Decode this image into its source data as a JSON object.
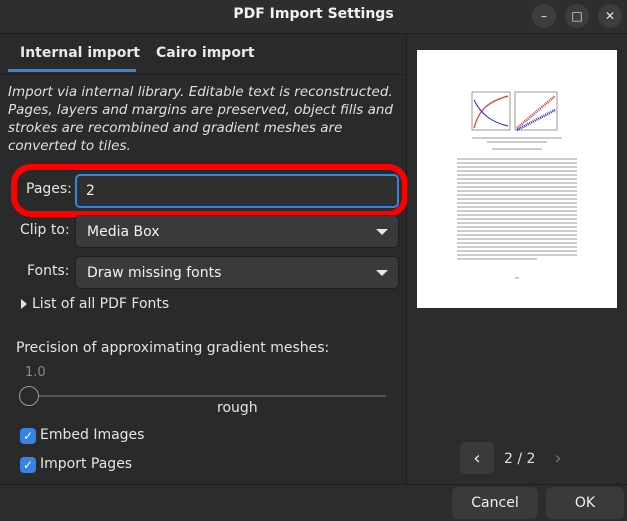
{
  "window": {
    "title": "PDF Import Settings"
  },
  "window_buttons": {
    "minimize": "–",
    "maximize": "□",
    "close": "✕"
  },
  "tabs": [
    {
      "label": "Internal import",
      "selected": true
    },
    {
      "label": "Cairo import",
      "selected": false
    }
  ],
  "description": "Import via internal library. Editable text is reconstructed. Pages, layers and margins are preserved, object fills and strokes are recombined and gradient meshes are converted to tiles.",
  "pages": {
    "label": "Pages:",
    "value": "2"
  },
  "clip": {
    "label": "Clip to:",
    "value": "Media Box"
  },
  "fonts": {
    "label": "Fonts:",
    "value": "Draw missing fonts"
  },
  "font_list": {
    "label": "List of all PDF Fonts"
  },
  "precision": {
    "label": "Precision of approximating gradient meshes:",
    "value_text": "1.0",
    "value": 1.0,
    "scale_label": "rough"
  },
  "options": {
    "embed_images": {
      "label": "Embed Images",
      "checked": true
    },
    "import_pages": {
      "label": "Import Pages",
      "checked": true
    }
  },
  "preview": {
    "page_indicator": "2 / 2"
  },
  "footer": {
    "cancel_label": "Cancel",
    "ok_label": "OK"
  },
  "colors": {
    "accent": "#3584e4",
    "highlight": "#ff0000",
    "background": "#2c2c2c"
  },
  "icons": {
    "expander": "triangle-right-icon",
    "checkbox": "checkmark-icon",
    "prev": "chevron-left-icon",
    "next": "chevron-right-icon"
  }
}
